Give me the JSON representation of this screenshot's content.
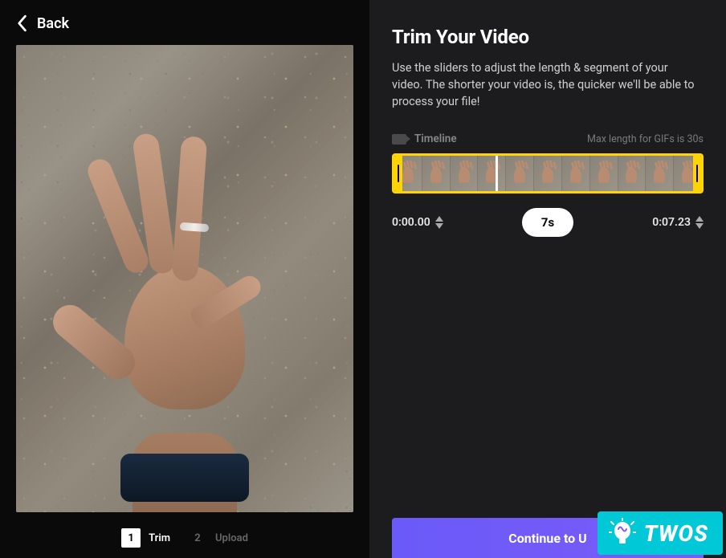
{
  "left_panel": {
    "back_label": "Back",
    "steps": [
      {
        "number": "1",
        "label": "Trim",
        "active": true
      },
      {
        "number": "2",
        "label": "Upload",
        "active": false
      }
    ]
  },
  "right_panel": {
    "title": "Trim Your Video",
    "description": "Use the sliders to adjust the length & segment of your video. The shorter your video is, the quicker we'll be able to process your file!",
    "timeline_label": "Timeline",
    "max_length_note": "Max length for GIFs is 30s",
    "start_time": "0:00.00",
    "end_time": "0:07.23",
    "duration_pill": "7s",
    "continue_label": "Continue to U",
    "frame_count": 11
  },
  "watermark": {
    "text": "TWOS"
  }
}
